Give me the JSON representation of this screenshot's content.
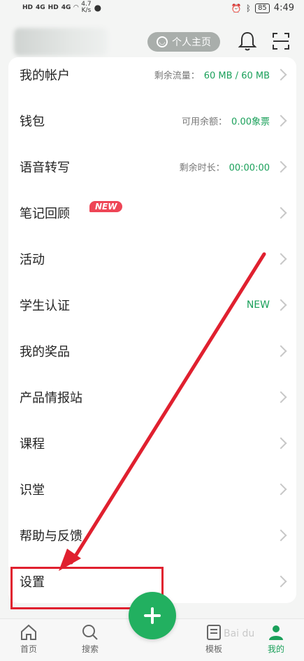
{
  "status_bar": {
    "sig1": "HD",
    "sig2": "HD",
    "net1": "4G",
    "net2": "4G",
    "speed_value": "4.7",
    "speed_unit": "K/s",
    "battery": "85",
    "time": "4:49"
  },
  "header": {
    "homepage_label": "个人主页"
  },
  "menu": [
    {
      "label": "我的帐户",
      "info_label": "剩余流量：",
      "info_value": "60 MB / 60 MB"
    },
    {
      "label": "钱包",
      "info_label": "可用余额：",
      "info_value": "0.00象票"
    },
    {
      "label": "语音转写",
      "info_label": "剩余时长：",
      "info_value": "00:00:00"
    },
    {
      "label": "笔记回顾",
      "badge": "NEW"
    },
    {
      "label": "活动"
    },
    {
      "label": "学生认证",
      "info_value": "NEW"
    },
    {
      "label": "我的奖品"
    },
    {
      "label": "产品情报站"
    },
    {
      "label": "课程"
    },
    {
      "label": "识堂"
    },
    {
      "label": "帮助与反馈"
    },
    {
      "label": "设置"
    }
  ],
  "bottom_nav": {
    "home": "首页",
    "search": "搜索",
    "templates": "模板",
    "mine": "我的"
  },
  "watermark": "Bai du",
  "colors": {
    "accent": "#1aa05a",
    "badge": "#ee4556",
    "annotation": "#e0202f"
  }
}
